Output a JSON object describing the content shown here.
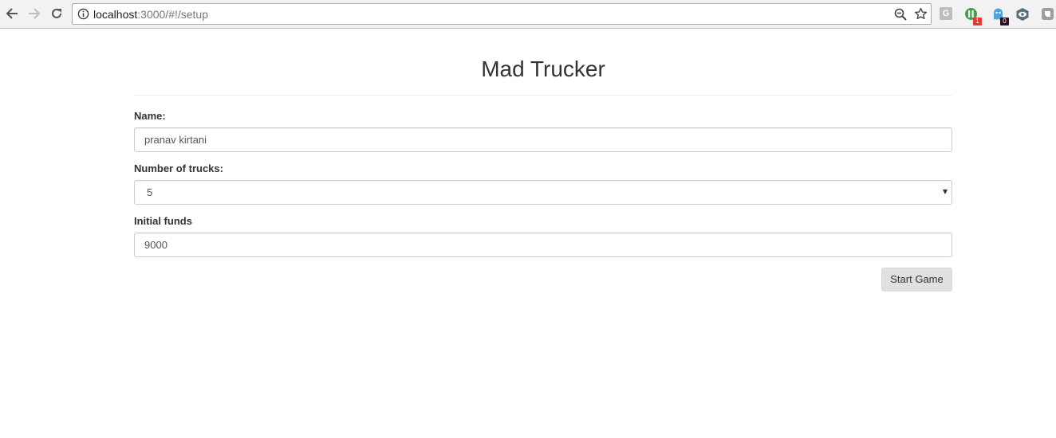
{
  "browser": {
    "url_host": "localhost",
    "url_rest": ":3000/#!/setup",
    "icons": {
      "back": "arrow-left",
      "forward": "arrow-right",
      "reload": "reload",
      "site_info": "info-circle",
      "zoom": "magnifier-minus",
      "bookmark": "star-outline"
    },
    "extensions": [
      {
        "name": "g-extension",
        "letter": "G",
        "color": "#bdbdbd"
      },
      {
        "name": "green-extension",
        "badge": "1",
        "badge_color": "#e53935",
        "color": "#43a047"
      },
      {
        "name": "ghost-extension",
        "badge": "0",
        "badge_color": "#2b1020",
        "color": "#4aa3df"
      },
      {
        "name": "eye-extension",
        "color": "#546e7a"
      },
      {
        "name": "pocket-extension",
        "color": "#9e9e9e"
      }
    ]
  },
  "page": {
    "title": "Mad Trucker",
    "form": {
      "name_label": "Name:",
      "name_value": "pranav kirtani",
      "trucks_label": "Number of trucks:",
      "trucks_value": "5",
      "funds_label": "Initial funds",
      "funds_value": "9000",
      "start_button": "Start Game"
    }
  }
}
